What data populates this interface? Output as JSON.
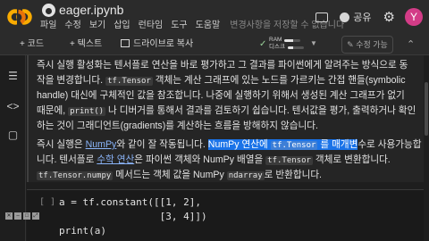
{
  "header": {
    "title": "eager.ipynb",
    "menu": [
      "파일",
      "수정",
      "보기",
      "삽입",
      "런타임",
      "도구",
      "도움말"
    ],
    "save_status": "변경사항을 저장할 수 없습니다",
    "share_label": "공유",
    "avatar_letter": "Y"
  },
  "toolbar": {
    "code_label": "+ 코드",
    "text_label": "+ 텍스트",
    "drive_label": "드라이브로 복사",
    "ram_label": "RAM",
    "disk_label": "디스크",
    "ram_usage": 0.55,
    "disk_usage": 0.35,
    "edit_mode_label": "✎ 수정 가능"
  },
  "text_cell": {
    "line1": "즉시 실행 활성화는 텐서플로 연산을 바로 평가하고 그 결과를 파이썬에게 알려주는 방식으로 동",
    "line2": "작을 변경합니다. ",
    "line2_code": "tf.Tensor",
    "line2_rest": " 객체는 계산 그래프에 있는 노드를 가르키는 간접 핸들(symbolic",
    "line3": "handle) 대신에 구체적인 값을 참조합니다. 나중에 실행하기 위해서 생성된 계산 그래프가 없기",
    "line4a": "때문에, ",
    "line4_code": "print()",
    "line4b": " 나 디버거를 통해서 결과를 검토하기 쉽습니다. 텐서값을 평가, 출력하거나 확인",
    "line5": "하는 것이 그래디언트(gradients)를 계산하는 흐름을 방해하지 않습니다.",
    "p2_line1a": "즉시 실행은 ",
    "p2_link1": "NumPy",
    "p2_line1b": "와 같이 잘 작동됩니다. ",
    "p2_hl1": "NumPy 연산에 ",
    "p2_hl_code": "tf.Tensor",
    "p2_hl2": " 를 매개변",
    "p2_line1c": "수로 사용가능합",
    "p2_line2a": "니다. 텐서플로 ",
    "p2_link2": "수학 연산",
    "p2_line2b": "은 파이썬 객체와 NumPy 배열을 ",
    "p2_line2_code": "tf.Tensor",
    "p2_line2c": " 객체로 변환합니다.",
    "p2_line3_code1": "tf.Tensor.numpy",
    "p2_line3a": " 메서드는 객체 값을 NumPy ",
    "p2_line3_code2": "ndarray",
    "p2_line3b": "로 반환합니다."
  },
  "code_cell": {
    "bracket": "[ ]",
    "lines": [
      "a = tf.constant([[1, 2],",
      "                 [3, 4]])",
      "print(a)"
    ]
  }
}
